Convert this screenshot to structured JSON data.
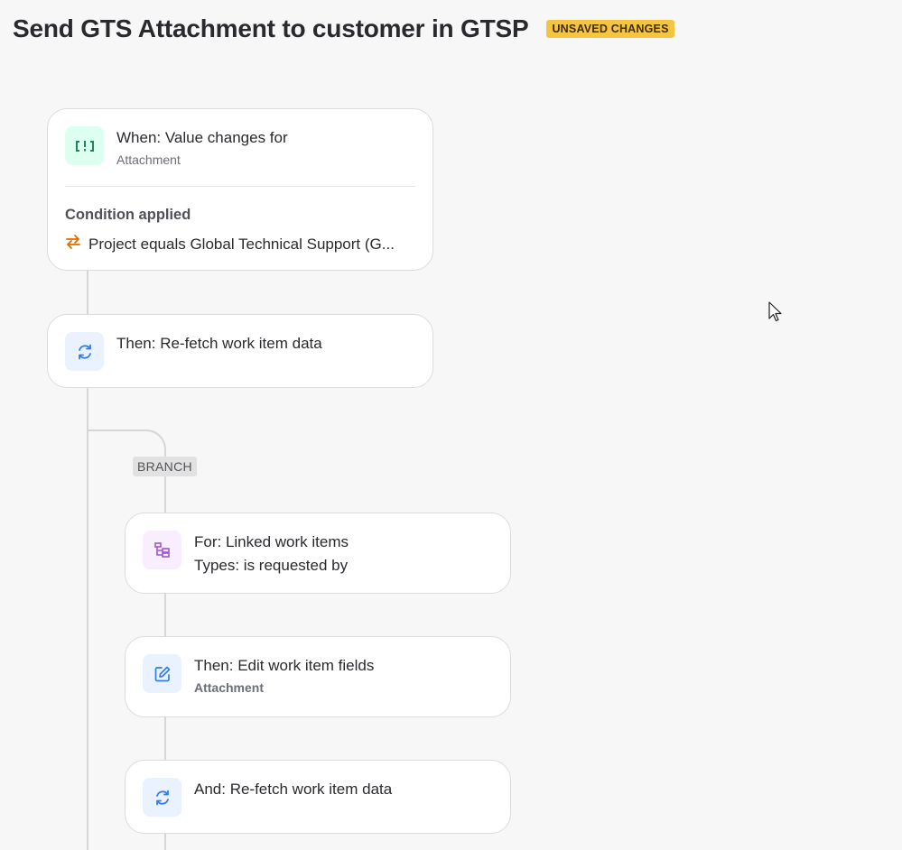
{
  "page": {
    "title": "Send GTS Attachment to customer in GTSP",
    "badge": "UNSAVED CHANGES"
  },
  "trigger": {
    "icon": "value-change-icon",
    "title": "When: Value changes for",
    "subtitle": "Attachment",
    "condition_label": "Condition applied",
    "condition_icon": "swap-arrows-icon",
    "condition_text": "Project equals Global Technical Support (G..."
  },
  "action_refetch": {
    "icon": "refresh-icon",
    "title": "Then: Re-fetch work item data"
  },
  "branch": {
    "label": "BRANCH",
    "for_card": {
      "icon": "linked-items-icon",
      "title": "For: Linked work items",
      "subtitle": "Types: is requested by"
    },
    "edit_card": {
      "icon": "edit-icon",
      "title": "Then: Edit work item fields",
      "subtitle": "Attachment"
    },
    "refetch_card": {
      "icon": "refresh-icon",
      "title": "And: Re-fetch work item data"
    }
  },
  "colors": {
    "badge": "#f5c542",
    "green_icon": "#1f845a",
    "blue_icon": "#357de8",
    "purple_icon": "#a054d4",
    "orange_icon": "#e06c00"
  }
}
